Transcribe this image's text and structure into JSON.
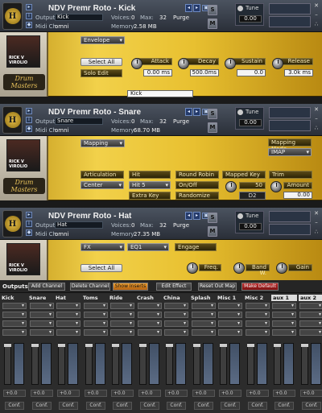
{
  "instruments": [
    {
      "title": "NDV Premr Roto - Kick",
      "output": "Kick",
      "midi": "omni",
      "voices": "0",
      "max": "32",
      "purge": "Purge",
      "memory": "2.58 MB",
      "tune_label": "Tune",
      "tune_value": "0.00"
    },
    {
      "title": "NDV Premr Roto - Snare",
      "output": "Snare",
      "midi": "omni",
      "voices": "0",
      "max": "32",
      "purge": "Purge",
      "memory": "68.70 MB",
      "tune_label": "Tune",
      "tune_value": "0.00"
    },
    {
      "title": "NDV Premr Roto - Hat",
      "output": "Hat",
      "midi": "omni",
      "voices": "0",
      "max": "32",
      "purge": "Purge",
      "memory": "27.35 MB",
      "tune_label": "Tune",
      "tune_value": "0.00"
    }
  ],
  "labels": {
    "output": "Output:",
    "midi": "Midi Ch:",
    "voices": "Voices:",
    "max": "Max:",
    "memory": "Memory:",
    "s": "S",
    "m": "M",
    "photo_name": "RICK V VIROLIO",
    "brand": "Drum Masters"
  },
  "kick": {
    "menu": "Envelope",
    "select_all": "Select All",
    "solo_edit": "Solo Edit",
    "attack": "Attack",
    "attack_val": "0.00 ms",
    "decay": "Decay",
    "decay_val": "500.0ms",
    "sustain": "Sustain",
    "sustain_val": "0.0",
    "release": "Release",
    "release_val": "3.0k ms",
    "name_field": "Kick"
  },
  "snare": {
    "menu": "Mapping",
    "mapping_mode": "Mapping Mode",
    "mode_val": "IMAP",
    "articulation": "Articulation",
    "center": "Center",
    "hit": "Hit",
    "hit5": "Hit 5",
    "extra_key": "Extra Key",
    "round_robin": "Round Robin",
    "on_off": "On/Off",
    "randomize": "Randomize",
    "mapped_key": "Mapped Key",
    "key_val": "50",
    "key_name": "D2",
    "trim": "Trim",
    "amount": "Amount",
    "amount_val": "0.00"
  },
  "hat": {
    "menu": "FX",
    "eq": "EQ1",
    "engage": "Engage",
    "select_all": "Select All",
    "freq": "Freq.",
    "band": "Band W.",
    "gain": "Gain"
  },
  "mixer": {
    "outputs": "Outputs",
    "add": "Add Channel",
    "delete": "Delete Channel",
    "show_inserts": "Show Inserts",
    "edit_effect": "Edit Effect",
    "reset": "Reset Out Map",
    "make_default": "Make Default",
    "channels": [
      "Kick",
      "Snare",
      "Hat",
      "Toms",
      "Ride",
      "Crash",
      "China",
      "Splash",
      "Misc 1",
      "Misc 2",
      "aux 1",
      "aux 2"
    ],
    "level": "+0.0",
    "conf": "Conf."
  }
}
